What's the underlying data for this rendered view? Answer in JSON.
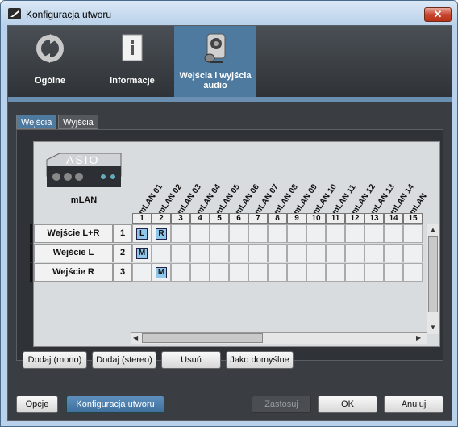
{
  "window": {
    "title": "Konfiguracja utworu",
    "close_label": "✕"
  },
  "top_tabs": [
    {
      "label": "Ogólne",
      "icon": "refresh-icon"
    },
    {
      "label": "Informacje",
      "icon": "document-icon"
    },
    {
      "label": "Wejścia i wyjścia audio",
      "icon": "microphone-speaker-icon",
      "selected": true
    }
  ],
  "sub_tabs": [
    {
      "label": "Wejścia",
      "selected": true
    },
    {
      "label": "Wyjścia"
    }
  ],
  "device": {
    "logo_text": "ASIO",
    "name": "mLAN"
  },
  "channels": [
    "mLAN 01",
    "mLAN 02",
    "mLAN 03",
    "mLAN 04",
    "mLAN 05",
    "mLAN 06",
    "mLAN 07",
    "mLAN 08",
    "mLAN 09",
    "mLAN 10",
    "mLAN 11",
    "mLAN 12",
    "mLAN 13",
    "mLAN 14",
    "mLAN"
  ],
  "channel_numbers": [
    "1",
    "2",
    "3",
    "4",
    "5",
    "6",
    "7",
    "8",
    "9",
    "10",
    "11",
    "12",
    "13",
    "14",
    "15"
  ],
  "rows": [
    {
      "label": "Wejście L+R",
      "num": "1",
      "assign": {
        "0": "L",
        "1": "R"
      }
    },
    {
      "label": "Wejście L",
      "num": "2",
      "assign": {
        "0": "M"
      }
    },
    {
      "label": "Wejście R",
      "num": "3",
      "assign": {
        "1": "M"
      }
    }
  ],
  "actions": {
    "add_mono": "Dodaj (mono)",
    "add_stereo": "Dodaj (stereo)",
    "remove": "Usuń",
    "default": "Jako domyślne"
  },
  "footer": {
    "options": "Opcje",
    "song_config": "Konfiguracja utworu",
    "apply": "Zastosuj",
    "ok": "OK",
    "cancel": "Anuluj"
  },
  "colors": {
    "accent": "#4e7aa0",
    "tag": "#8ec7ea"
  }
}
